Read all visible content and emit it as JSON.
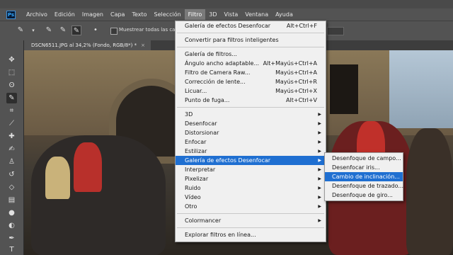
{
  "app": {
    "logo": "Ps"
  },
  "menubar": {
    "items": [
      "Archivo",
      "Edición",
      "Imagen",
      "Capa",
      "Texto",
      "Selección",
      "Filtro",
      "3D",
      "Vista",
      "Ventana",
      "Ayuda"
    ],
    "active": "Filtro"
  },
  "options": {
    "sample_all_layers_label": "Muestrear todas las capas"
  },
  "document": {
    "tab_title": "DSCN6511.JPG al 34,2% (Fondo, RGB/8*) *",
    "close_glyph": "×"
  },
  "filter_menu": {
    "group1": [
      {
        "label": "Galería de efectos Desenfocar",
        "shortcut": "Alt+Ctrl+F"
      }
    ],
    "group2": [
      {
        "label": "Convertir para filtros inteligentes",
        "shortcut": ""
      }
    ],
    "group3": [
      {
        "label": "Galería de filtros...",
        "shortcut": ""
      },
      {
        "label": "Ángulo ancho adaptable...",
        "shortcut": "Alt+Mayús+Ctrl+A"
      },
      {
        "label": "Filtro de Camera Raw...",
        "shortcut": "Mayús+Ctrl+A"
      },
      {
        "label": "Corrección de lente...",
        "shortcut": "Mayús+Ctrl+R"
      },
      {
        "label": "Licuar...",
        "shortcut": "Mayús+Ctrl+X"
      },
      {
        "label": "Punto de fuga...",
        "shortcut": "Alt+Ctrl+V"
      }
    ],
    "group4": [
      {
        "label": "3D"
      },
      {
        "label": "Desenfocar"
      },
      {
        "label": "Distorsionar"
      },
      {
        "label": "Enfocar"
      },
      {
        "label": "Estilizar"
      },
      {
        "label": "Galería de efectos Desenfocar"
      },
      {
        "label": "Interpretar"
      },
      {
        "label": "Pixelizar"
      },
      {
        "label": "Ruido"
      },
      {
        "label": "Vídeo"
      },
      {
        "label": "Otro"
      }
    ],
    "group5": [
      {
        "label": "Colormancer"
      }
    ],
    "group6": [
      {
        "label": "Explorar filtros en línea..."
      }
    ],
    "highlighted": "Galería de efectos Desenfocar"
  },
  "submenu": {
    "items": [
      "Desenfoque de campo...",
      "Desenfocar iris...",
      "Cambio de inclinación...",
      "Desenfoque de trazado...",
      "Desenfoque de giro..."
    ],
    "highlighted": "Cambio de inclinación..."
  },
  "icons": {
    "submenu_arrow": "▶",
    "tools": [
      "move-icon",
      "marquee-icon",
      "lasso-icon",
      "quick-select-icon",
      "crop-icon",
      "eyedropper-icon",
      "healing-brush-icon",
      "brush-icon",
      "clone-stamp-icon",
      "history-brush-icon",
      "eraser-icon",
      "gradient-icon",
      "blur-icon",
      "dodge-icon",
      "pen-icon",
      "type-icon"
    ]
  },
  "colors": {
    "menu_highlight": "#1f6fd1",
    "menubar_bg": "#535353",
    "menu_bg": "#f0f0f0"
  }
}
